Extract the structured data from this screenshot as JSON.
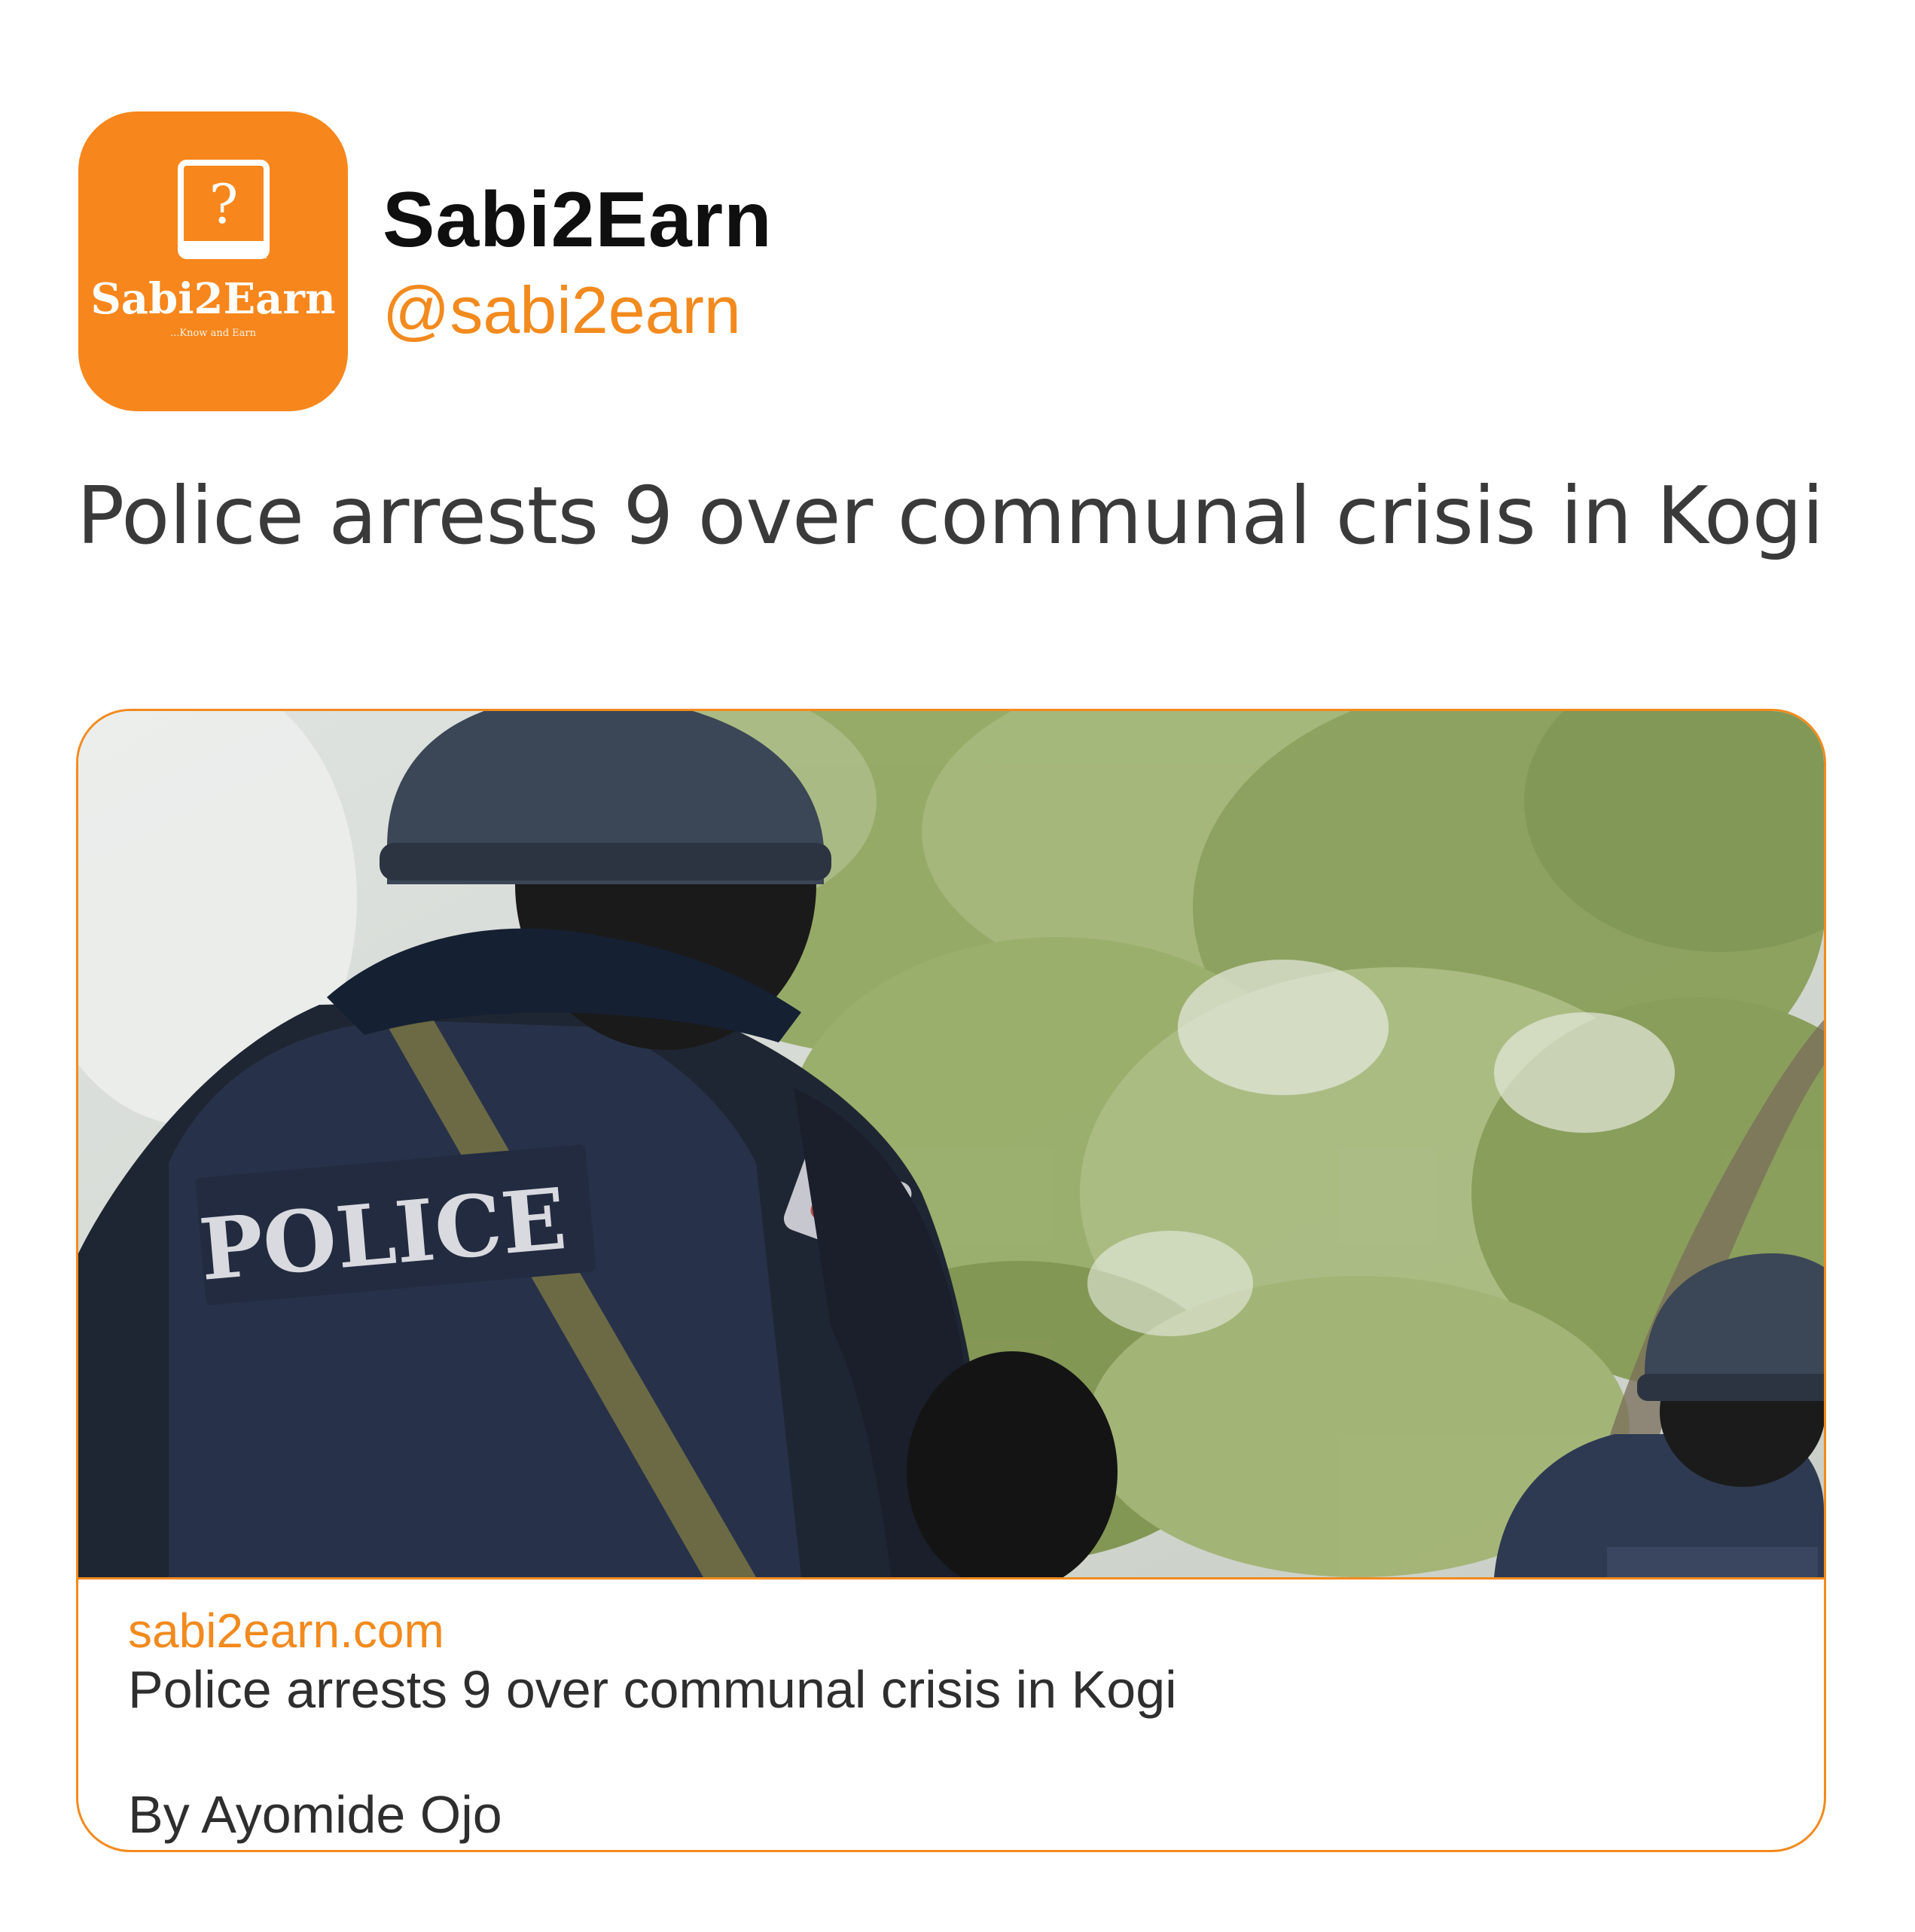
{
  "profile": {
    "display_name": "Sabi2Earn",
    "handle": "@sabi2earn",
    "avatar": {
      "logo_wordmark": "Sabi2Earn",
      "logo_tagline": "...Know and Earn",
      "logo_icon": "book-question-icon",
      "background_color": "#f7861c"
    }
  },
  "post": {
    "text": "Police arrests 9 over communal crisis in Kogi"
  },
  "link_card": {
    "image_description_icon": "police-officers-photo",
    "image_badge_text": "POLICE",
    "domain": "sabi2earn.com",
    "title": "Police arrests 9 over communal crisis in Kogi",
    "description": "By Ayomide Ojo"
  },
  "colors": {
    "accent": "#f28a1e",
    "text_primary": "#0f0f0f",
    "text_secondary": "#333333"
  }
}
